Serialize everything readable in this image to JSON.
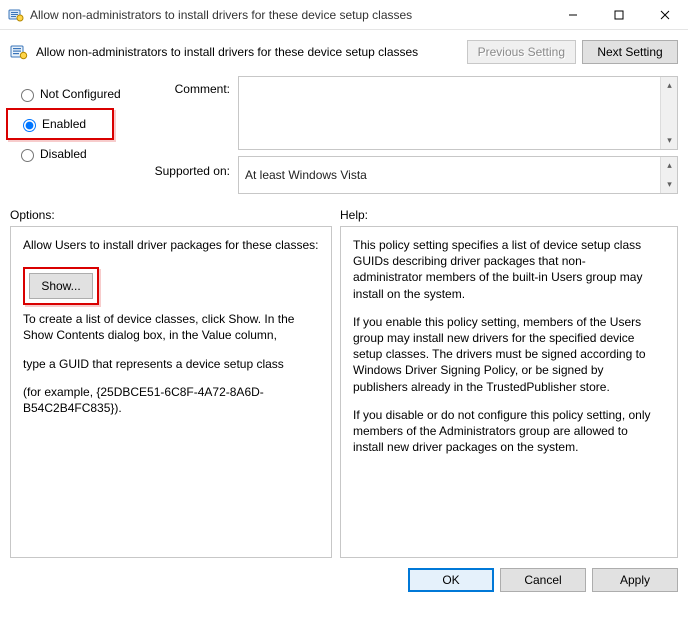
{
  "window": {
    "title": "Allow non-administrators to install drivers for these device setup classes"
  },
  "header": {
    "policy_title": "Allow non-administrators to install drivers for these device setup classes",
    "prev_label": "Previous Setting",
    "next_label": "Next Setting"
  },
  "radios": {
    "not_configured": "Not Configured",
    "enabled": "Enabled",
    "disabled": "Disabled"
  },
  "labels": {
    "comment": "Comment:",
    "supported_on": "Supported on:",
    "options": "Options:",
    "help": "Help:"
  },
  "supported": {
    "text": "At least Windows Vista"
  },
  "options_panel": {
    "intro": "Allow Users to install driver packages for these classes:",
    "show_label": "Show...",
    "instr1": "To create a list of device classes, click Show. In the Show Contents dialog box, in the Value column,",
    "instr2": "type a GUID that represents a device setup class",
    "example": "(for example, {25DBCE51-6C8F-4A72-8A6D-B54C2B4FC835})."
  },
  "help_panel": {
    "p1": "This policy setting specifies a list of device setup class GUIDs describing driver packages that non-administrator members of the built-in Users group may install on the system.",
    "p2": "If you enable this policy setting, members of the Users group may install new drivers for the specified device setup classes. The drivers must be signed according to Windows Driver Signing Policy, or be signed by publishers already in the TrustedPublisher store.",
    "p3": "If you disable or do not configure this policy setting, only members of the Administrators group are allowed to install new driver packages on the system."
  },
  "footer": {
    "ok": "OK",
    "cancel": "Cancel",
    "apply": "Apply"
  }
}
